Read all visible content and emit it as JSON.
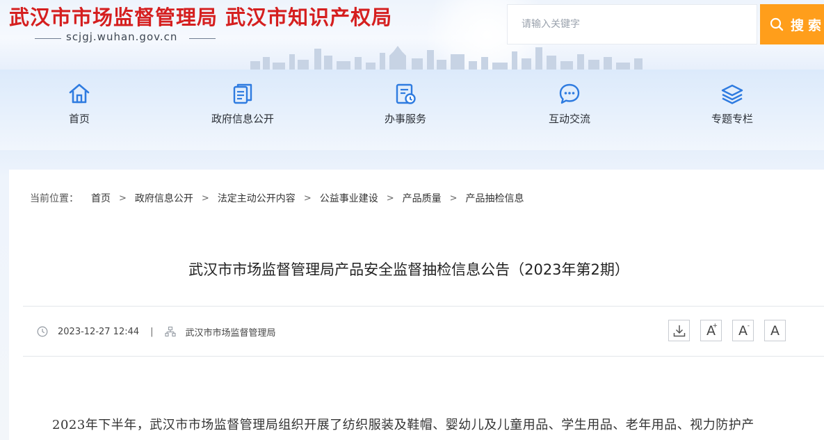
{
  "header": {
    "site_title": "武汉市市场监督管理局 武汉市知识产权局",
    "site_domain": "scjgj.wuhan.gov.cn",
    "search_placeholder": "请输入关键字",
    "search_button_label": "搜索",
    "colors": {
      "title_red": "#d51f1f",
      "search_orange": "#ff9e1b",
      "nav_blue": "#2e7be0"
    }
  },
  "nav": {
    "items": [
      {
        "label": "首页",
        "icon": "home-icon"
      },
      {
        "label": "政府信息公开",
        "icon": "document-icon"
      },
      {
        "label": "办事服务",
        "icon": "service-icon"
      },
      {
        "label": "互动交流",
        "icon": "chat-bubble-icon"
      },
      {
        "label": "专题专栏",
        "icon": "layers-icon"
      }
    ]
  },
  "breadcrumb": {
    "label": "当前位置：",
    "items": [
      "首页",
      "政府信息公开",
      "法定主动公开内容",
      "公益事业建设",
      "产品质量",
      "产品抽检信息"
    ]
  },
  "article": {
    "title": "武汉市市场监督管理局产品安全监督抽检信息公告（2023年第2期）",
    "date": "2023-12-27 12:44",
    "separator": "|",
    "source": "武汉市市场监督管理局",
    "tools": {
      "font_increase": "A",
      "font_decrease": "A",
      "font_reset": "A"
    },
    "body_first_line": "2023年下半年，武汉市市场监督管理局组织开展了纺织服装及鞋帽、婴幼儿及儿童用品、学生用品、老年用品、视力防护产"
  }
}
